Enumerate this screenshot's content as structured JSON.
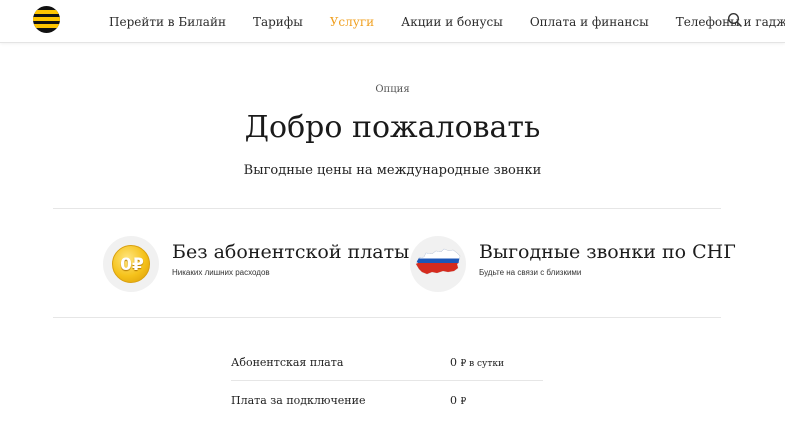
{
  "header": {
    "logo_icon": "beeline-logo",
    "nav": [
      {
        "label": "Перейти в Билайн",
        "active": false
      },
      {
        "label": "Тарифы",
        "active": false
      },
      {
        "label": "Услуги",
        "active": true
      },
      {
        "label": "Акции и бонусы",
        "active": false
      },
      {
        "label": "Оплата и финансы",
        "active": false
      },
      {
        "label": "Телефоны и гаджеты",
        "active": false
      }
    ],
    "search_icon": "search-icon"
  },
  "hero": {
    "kicker": "Опция",
    "title": "Добро пожаловать",
    "subtitle": "Выгодные цены на международные звонки"
  },
  "features": [
    {
      "title": "Без абонентской платы",
      "subtitle": "Никаких лишних расходов",
      "icon": "zero-ruble-coin-icon",
      "icon_text": "0₽"
    },
    {
      "title": "Выгодные звонки по СНГ",
      "subtitle": "Будьте на связи с близкими",
      "icon": "russia-map-icon"
    }
  ],
  "pricing": [
    {
      "label": "Абонентская плата",
      "value": "0",
      "unit": "₽ в сутки"
    },
    {
      "label": "Плата за подключение",
      "value": "0",
      "unit": "₽"
    }
  ],
  "colors": {
    "accent": "#f0a020",
    "brand_yellow": "#fec400",
    "brand_black": "#111111"
  }
}
